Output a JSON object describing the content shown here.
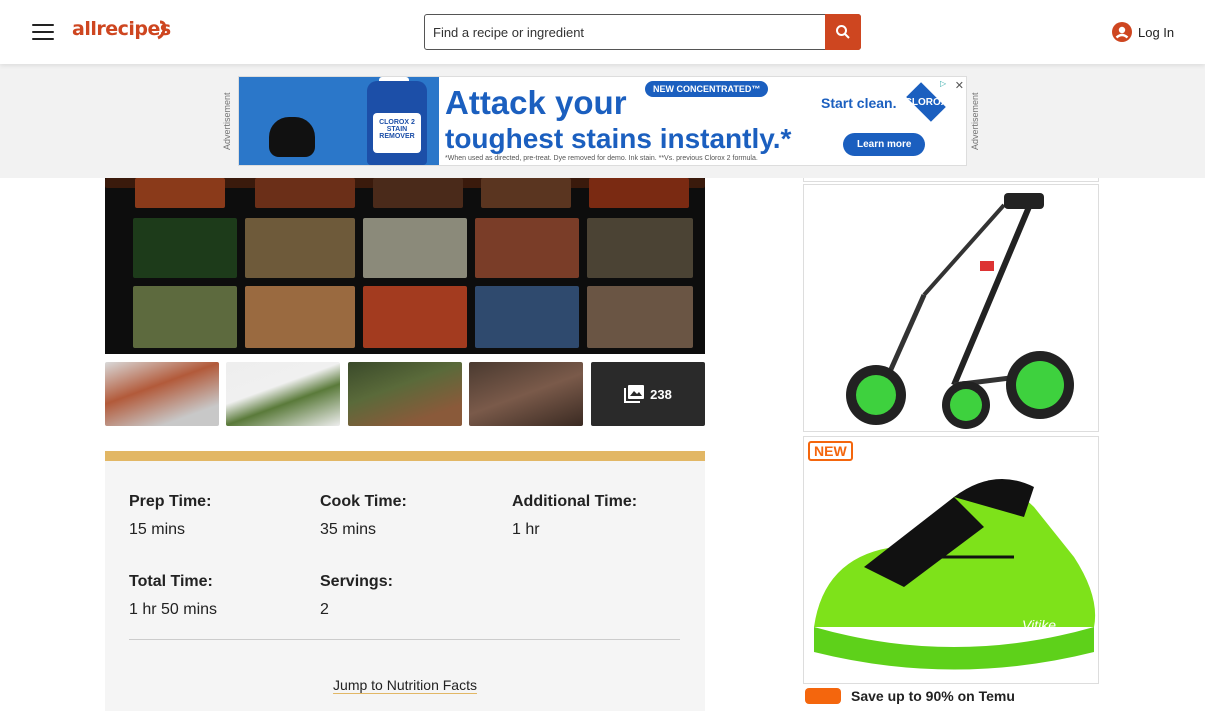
{
  "header": {
    "logo_text": "allrecipes",
    "search_placeholder": "Find a recipe or ingredient",
    "login_label": "Log In",
    "menu_icon": "hamburger-menu-icon",
    "search_icon": "search-icon",
    "account_icon": "account-icon"
  },
  "ad_banner": {
    "side_label": "Advertisement",
    "headline_line1": "Attack your",
    "headline_line2": "toughest stains instantly.*",
    "pill": "NEW CONCENTRATED™",
    "fine_print": "*When used as directed, pre-treat. Dye removed for demo. Ink stain. **Vs. previous Clorox 2 formula.",
    "cta_tagline": "Start clean.",
    "brand": "CLOROX",
    "cta_button": "Learn more",
    "bottle_label": "CLOROX 2 STAIN REMOVER"
  },
  "gallery": {
    "more_count": "238",
    "gallery_icon": "photo-library-icon"
  },
  "recipe_details": {
    "prep_time_label": "Prep Time:",
    "prep_time_value": "15 mins",
    "cook_time_label": "Cook Time:",
    "cook_time_value": "35 mins",
    "additional_time_label": "Additional Time:",
    "additional_time_value": "1 hr",
    "total_time_label": "Total Time:",
    "total_time_value": "1 hr 50 mins",
    "servings_label": "Servings:",
    "servings_value": "2",
    "jump_link": "Jump to Nutrition Facts"
  },
  "side_ads": {
    "new_badge": "NEW",
    "shoe_brand": "Vitike",
    "temu_text": "Save up to 90% on Temu"
  },
  "colors": {
    "brand": "#ce4620",
    "card_accent": "#e2b765",
    "ad_blue": "#1b5fbf"
  }
}
